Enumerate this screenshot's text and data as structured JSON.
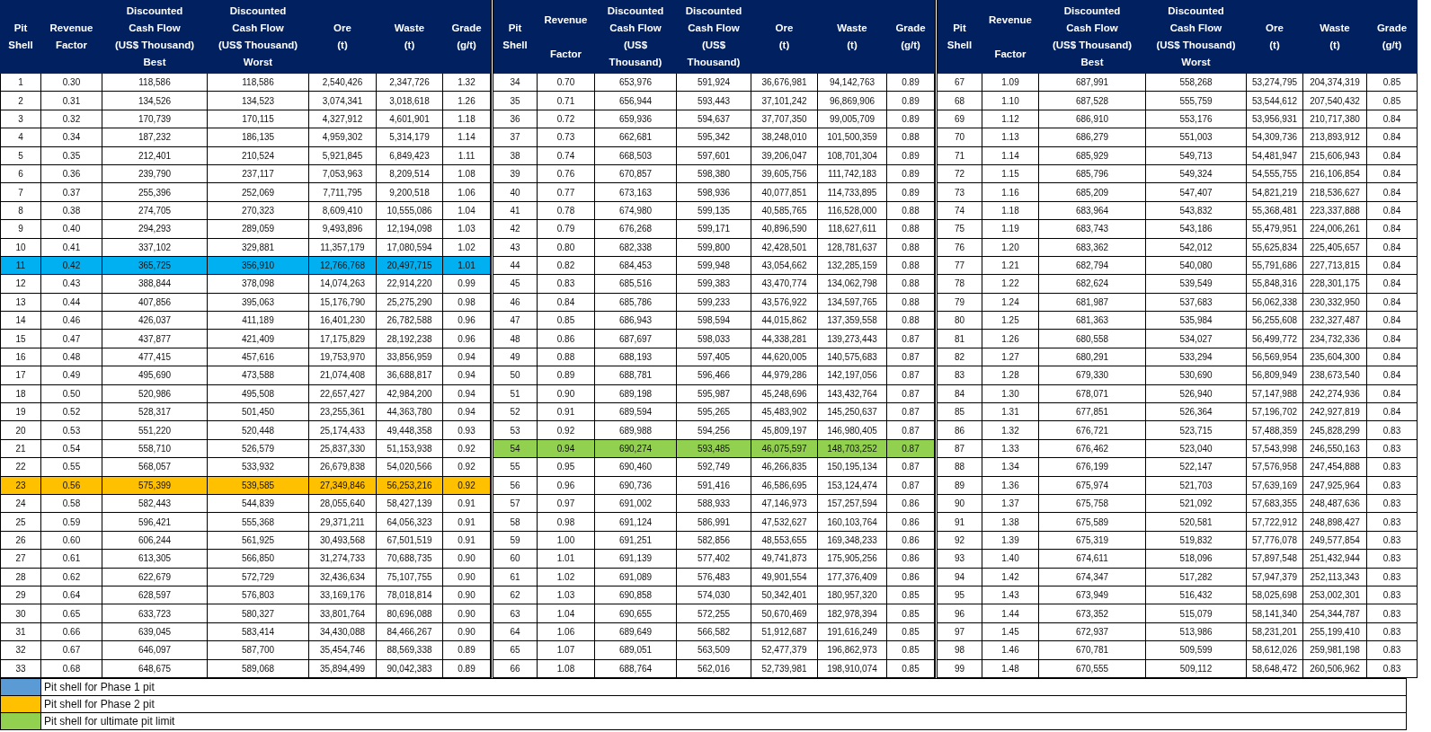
{
  "blocks": [
    {
      "columns": [
        "Pit\nShell",
        "Revenue\nFactor",
        "Discounted\nCash Flow\n(US$ Thousand)\nBest",
        "Discounted\nCash Flow\n(US$ Thousand)\nWorst",
        "Ore\n(t)",
        "Waste\n(t)",
        "Grade\n(g/t)"
      ],
      "rows": [
        {
          "cells": [
            "1",
            "0.30",
            "118,586",
            "118,586",
            "2,540,426",
            "2,347,726",
            "1.32"
          ]
        },
        {
          "cells": [
            "2",
            "0.31",
            "134,526",
            "134,523",
            "3,074,341",
            "3,018,618",
            "1.26"
          ]
        },
        {
          "cells": [
            "3",
            "0.32",
            "170,739",
            "170,115",
            "4,327,912",
            "4,601,901",
            "1.18"
          ]
        },
        {
          "cells": [
            "4",
            "0.34",
            "187,232",
            "186,135",
            "4,959,302",
            "5,314,179",
            "1.14"
          ]
        },
        {
          "cells": [
            "5",
            "0.35",
            "212,401",
            "210,524",
            "5,921,845",
            "6,849,423",
            "1.11"
          ]
        },
        {
          "cells": [
            "6",
            "0.36",
            "239,790",
            "237,117",
            "7,053,963",
            "8,209,514",
            "1.08"
          ]
        },
        {
          "cells": [
            "7",
            "0.37",
            "255,396",
            "252,069",
            "7,711,795",
            "9,200,518",
            "1.06"
          ]
        },
        {
          "cells": [
            "8",
            "0.38",
            "274,705",
            "270,323",
            "8,609,410",
            "10,555,086",
            "1.04"
          ]
        },
        {
          "cells": [
            "9",
            "0.40",
            "294,293",
            "289,059",
            "9,493,896",
            "12,194,098",
            "1.03"
          ]
        },
        {
          "cells": [
            "10",
            "0.41",
            "337,102",
            "329,881",
            "11,357,179",
            "17,080,594",
            "1.02"
          ]
        },
        {
          "cells": [
            "11",
            "0.42",
            "365,725",
            "356,910",
            "12,766,768",
            "20,497,715",
            "1.01"
          ],
          "color": "#00b0f0"
        },
        {
          "cells": [
            "12",
            "0.43",
            "388,844",
            "378,098",
            "14,074,263",
            "22,914,220",
            "0.99"
          ]
        },
        {
          "cells": [
            "13",
            "0.44",
            "407,856",
            "395,063",
            "15,176,790",
            "25,275,290",
            "0.98"
          ]
        },
        {
          "cells": [
            "14",
            "0.46",
            "426,037",
            "411,189",
            "16,401,230",
            "26,782,588",
            "0.96"
          ]
        },
        {
          "cells": [
            "15",
            "0.47",
            "437,877",
            "421,409",
            "17,175,829",
            "28,192,238",
            "0.96"
          ]
        },
        {
          "cells": [
            "16",
            "0.48",
            "477,415",
            "457,616",
            "19,753,970",
            "33,856,959",
            "0.94"
          ]
        },
        {
          "cells": [
            "17",
            "0.49",
            "495,690",
            "473,588",
            "21,074,408",
            "36,688,817",
            "0.94"
          ]
        },
        {
          "cells": [
            "18",
            "0.50",
            "520,986",
            "495,508",
            "22,657,427",
            "42,984,200",
            "0.94"
          ]
        },
        {
          "cells": [
            "19",
            "0.52",
            "528,317",
            "501,450",
            "23,255,361",
            "44,363,780",
            "0.94"
          ]
        },
        {
          "cells": [
            "20",
            "0.53",
            "551,220",
            "520,448",
            "25,174,433",
            "49,448,358",
            "0.93"
          ]
        },
        {
          "cells": [
            "21",
            "0.54",
            "558,710",
            "526,579",
            "25,837,330",
            "51,153,938",
            "0.92"
          ]
        },
        {
          "cells": [
            "22",
            "0.55",
            "568,057",
            "533,932",
            "26,679,838",
            "54,020,566",
            "0.92"
          ]
        },
        {
          "cells": [
            "23",
            "0.56",
            "575,399",
            "539,585",
            "27,349,846",
            "56,253,216",
            "0.92"
          ],
          "color": "#ffc000"
        },
        {
          "cells": [
            "24",
            "0.58",
            "582,443",
            "544,839",
            "28,055,640",
            "58,427,139",
            "0.91"
          ]
        },
        {
          "cells": [
            "25",
            "0.59",
            "596,421",
            "555,368",
            "29,371,211",
            "64,056,323",
            "0.91"
          ]
        },
        {
          "cells": [
            "26",
            "0.60",
            "606,244",
            "561,925",
            "30,493,568",
            "67,501,519",
            "0.91"
          ]
        },
        {
          "cells": [
            "27",
            "0.61",
            "613,305",
            "566,850",
            "31,274,733",
            "70,688,735",
            "0.90"
          ]
        },
        {
          "cells": [
            "28",
            "0.62",
            "622,679",
            "572,729",
            "32,436,634",
            "75,107,755",
            "0.90"
          ]
        },
        {
          "cells": [
            "29",
            "0.64",
            "628,597",
            "576,803",
            "33,169,176",
            "78,018,814",
            "0.90"
          ]
        },
        {
          "cells": [
            "30",
            "0.65",
            "633,723",
            "580,327",
            "33,801,764",
            "80,696,088",
            "0.90"
          ]
        },
        {
          "cells": [
            "31",
            "0.66",
            "639,045",
            "583,414",
            "34,430,088",
            "84,466,267",
            "0.90"
          ]
        },
        {
          "cells": [
            "32",
            "0.67",
            "646,097",
            "587,700",
            "35,454,746",
            "88,569,338",
            "0.89"
          ]
        },
        {
          "cells": [
            "33",
            "0.68",
            "648,675",
            "589,068",
            "35,894,499",
            "90,042,383",
            "0.89"
          ]
        }
      ]
    },
    {
      "columns": [
        "Pit\nShell",
        "Revenue\n\nFactor",
        "Discounted\nCash Flow\n(US$\nThousand)",
        "Discounted\nCash Flow\n(US$\nThousand)",
        "Ore\n(t)",
        "Waste\n(t)",
        "Grade\n(g/t)"
      ],
      "rows": [
        {
          "cells": [
            "34",
            "0.70",
            "653,976",
            "591,924",
            "36,676,981",
            "94,142,763",
            "0.89"
          ]
        },
        {
          "cells": [
            "35",
            "0.71",
            "656,944",
            "593,443",
            "37,101,242",
            "96,869,906",
            "0.89"
          ]
        },
        {
          "cells": [
            "36",
            "0.72",
            "659,936",
            "594,637",
            "37,707,350",
            "99,005,709",
            "0.89"
          ]
        },
        {
          "cells": [
            "37",
            "0.73",
            "662,681",
            "595,342",
            "38,248,010",
            "101,500,359",
            "0.88"
          ]
        },
        {
          "cells": [
            "38",
            "0.74",
            "668,503",
            "597,601",
            "39,206,047",
            "108,701,304",
            "0.89"
          ]
        },
        {
          "cells": [
            "39",
            "0.76",
            "670,857",
            "598,380",
            "39,605,756",
            "111,742,183",
            "0.89"
          ]
        },
        {
          "cells": [
            "40",
            "0.77",
            "673,163",
            "598,936",
            "40,077,851",
            "114,733,895",
            "0.89"
          ]
        },
        {
          "cells": [
            "41",
            "0.78",
            "674,980",
            "599,135",
            "40,585,765",
            "116,528,000",
            "0.88"
          ]
        },
        {
          "cells": [
            "42",
            "0.79",
            "676,268",
            "599,171",
            "40,896,590",
            "118,627,611",
            "0.88"
          ]
        },
        {
          "cells": [
            "43",
            "0.80",
            "682,338",
            "599,800",
            "42,428,501",
            "128,781,637",
            "0.88"
          ]
        },
        {
          "cells": [
            "44",
            "0.82",
            "684,453",
            "599,948",
            "43,054,662",
            "132,285,159",
            "0.88"
          ]
        },
        {
          "cells": [
            "45",
            "0.83",
            "685,516",
            "599,383",
            "43,470,774",
            "134,062,798",
            "0.88"
          ]
        },
        {
          "cells": [
            "46",
            "0.84",
            "685,786",
            "599,233",
            "43,576,922",
            "134,597,765",
            "0.88"
          ]
        },
        {
          "cells": [
            "47",
            "0.85",
            "686,943",
            "598,594",
            "44,015,862",
            "137,359,558",
            "0.88"
          ]
        },
        {
          "cells": [
            "48",
            "0.86",
            "687,697",
            "598,033",
            "44,338,281",
            "139,273,443",
            "0.87"
          ]
        },
        {
          "cells": [
            "49",
            "0.88",
            "688,193",
            "597,405",
            "44,620,005",
            "140,575,683",
            "0.87"
          ]
        },
        {
          "cells": [
            "50",
            "0.89",
            "688,781",
            "596,466",
            "44,979,286",
            "142,197,056",
            "0.87"
          ]
        },
        {
          "cells": [
            "51",
            "0.90",
            "689,198",
            "595,987",
            "45,248,696",
            "143,432,764",
            "0.87"
          ]
        },
        {
          "cells": [
            "52",
            "0.91",
            "689,594",
            "595,265",
            "45,483,902",
            "145,250,637",
            "0.87"
          ]
        },
        {
          "cells": [
            "53",
            "0.92",
            "689,988",
            "594,256",
            "45,809,197",
            "146,980,405",
            "0.87"
          ]
        },
        {
          "cells": [
            "54",
            "0.94",
            "690,274",
            "593,485",
            "46,075,597",
            "148,703,252",
            "0.87"
          ],
          "color": "#92d050"
        },
        {
          "cells": [
            "55",
            "0.95",
            "690,460",
            "592,749",
            "46,266,835",
            "150,195,134",
            "0.87"
          ]
        },
        {
          "cells": [
            "56",
            "0.96",
            "690,736",
            "591,416",
            "46,586,695",
            "153,124,474",
            "0.87"
          ]
        },
        {
          "cells": [
            "57",
            "0.97",
            "691,002",
            "588,933",
            "47,146,973",
            "157,257,594",
            "0.86"
          ]
        },
        {
          "cells": [
            "58",
            "0.98",
            "691,124",
            "586,991",
            "47,532,627",
            "160,103,764",
            "0.86"
          ]
        },
        {
          "cells": [
            "59",
            "1.00",
            "691,251",
            "582,856",
            "48,553,655",
            "169,348,233",
            "0.86"
          ]
        },
        {
          "cells": [
            "60",
            "1.01",
            "691,139",
            "577,402",
            "49,741,873",
            "175,905,256",
            "0.86"
          ]
        },
        {
          "cells": [
            "61",
            "1.02",
            "691,089",
            "576,483",
            "49,901,554",
            "177,376,409",
            "0.86"
          ]
        },
        {
          "cells": [
            "62",
            "1.03",
            "690,858",
            "574,030",
            "50,342,401",
            "180,957,320",
            "0.85"
          ]
        },
        {
          "cells": [
            "63",
            "1.04",
            "690,655",
            "572,255",
            "50,670,469",
            "182,978,394",
            "0.85"
          ]
        },
        {
          "cells": [
            "64",
            "1.06",
            "689,649",
            "566,582",
            "51,912,687",
            "191,616,249",
            "0.85"
          ]
        },
        {
          "cells": [
            "65",
            "1.07",
            "689,051",
            "563,509",
            "52,477,379",
            "196,862,973",
            "0.85"
          ]
        },
        {
          "cells": [
            "66",
            "1.08",
            "688,764",
            "562,016",
            "52,739,981",
            "198,910,074",
            "0.85"
          ]
        }
      ]
    },
    {
      "columns": [
        "Pit\nShell",
        "Revenue\n\nFactor",
        "Discounted\nCash Flow\n(US$ Thousand)\nBest",
        "Discounted\nCash Flow\n(US$ Thousand)\nWorst",
        "Ore\n(t)",
        "Waste\n(t)",
        "Grade\n(g/t)"
      ],
      "rows": [
        {
          "cells": [
            "67",
            "1.09",
            "687,991",
            "558,268",
            "53,274,795",
            "204,374,319",
            "0.85"
          ]
        },
        {
          "cells": [
            "68",
            "1.10",
            "687,528",
            "555,759",
            "53,544,612",
            "207,540,432",
            "0.85"
          ]
        },
        {
          "cells": [
            "69",
            "1.12",
            "686,910",
            "553,176",
            "53,956,931",
            "210,717,380",
            "0.84"
          ]
        },
        {
          "cells": [
            "70",
            "1.13",
            "686,279",
            "551,003",
            "54,309,736",
            "213,893,912",
            "0.84"
          ]
        },
        {
          "cells": [
            "71",
            "1.14",
            "685,929",
            "549,713",
            "54,481,947",
            "215,606,943",
            "0.84"
          ]
        },
        {
          "cells": [
            "72",
            "1.15",
            "685,796",
            "549,324",
            "54,555,755",
            "216,106,854",
            "0.84"
          ]
        },
        {
          "cells": [
            "73",
            "1.16",
            "685,209",
            "547,407",
            "54,821,219",
            "218,536,627",
            "0.84"
          ]
        },
        {
          "cells": [
            "74",
            "1.18",
            "683,964",
            "543,832",
            "55,368,481",
            "223,337,888",
            "0.84"
          ]
        },
        {
          "cells": [
            "75",
            "1.19",
            "683,743",
            "543,186",
            "55,479,951",
            "224,006,261",
            "0.84"
          ]
        },
        {
          "cells": [
            "76",
            "1.20",
            "683,362",
            "542,012",
            "55,625,834",
            "225,405,657",
            "0.84"
          ]
        },
        {
          "cells": [
            "77",
            "1.21",
            "682,794",
            "540,080",
            "55,791,686",
            "227,713,815",
            "0.84"
          ]
        },
        {
          "cells": [
            "78",
            "1.22",
            "682,624",
            "539,549",
            "55,848,316",
            "228,301,175",
            "0.84"
          ]
        },
        {
          "cells": [
            "79",
            "1.24",
            "681,987",
            "537,683",
            "56,062,338",
            "230,332,950",
            "0.84"
          ]
        },
        {
          "cells": [
            "80",
            "1.25",
            "681,363",
            "535,984",
            "56,255,608",
            "232,327,487",
            "0.84"
          ]
        },
        {
          "cells": [
            "81",
            "1.26",
            "680,558",
            "534,027",
            "56,499,772",
            "234,732,336",
            "0.84"
          ]
        },
        {
          "cells": [
            "82",
            "1.27",
            "680,291",
            "533,294",
            "56,569,954",
            "235,604,300",
            "0.84"
          ]
        },
        {
          "cells": [
            "83",
            "1.28",
            "679,330",
            "530,690",
            "56,809,949",
            "238,673,540",
            "0.84"
          ]
        },
        {
          "cells": [
            "84",
            "1.30",
            "678,071",
            "526,940",
            "57,147,988",
            "242,274,936",
            "0.84"
          ]
        },
        {
          "cells": [
            "85",
            "1.31",
            "677,851",
            "526,364",
            "57,196,702",
            "242,927,819",
            "0.84"
          ]
        },
        {
          "cells": [
            "86",
            "1.32",
            "676,721",
            "523,715",
            "57,488,359",
            "245,828,299",
            "0.83"
          ]
        },
        {
          "cells": [
            "87",
            "1.33",
            "676,462",
            "523,040",
            "57,543,998",
            "246,550,163",
            "0.83"
          ]
        },
        {
          "cells": [
            "88",
            "1.34",
            "676,199",
            "522,147",
            "57,576,958",
            "247,454,888",
            "0.83"
          ]
        },
        {
          "cells": [
            "89",
            "1.36",
            "675,974",
            "521,703",
            "57,639,169",
            "247,925,964",
            "0.83"
          ]
        },
        {
          "cells": [
            "90",
            "1.37",
            "675,758",
            "521,092",
            "57,683,355",
            "248,487,636",
            "0.83"
          ]
        },
        {
          "cells": [
            "91",
            "1.38",
            "675,589",
            "520,581",
            "57,722,912",
            "248,898,427",
            "0.83"
          ]
        },
        {
          "cells": [
            "92",
            "1.39",
            "675,319",
            "519,832",
            "57,776,078",
            "249,577,854",
            "0.83"
          ]
        },
        {
          "cells": [
            "93",
            "1.40",
            "674,611",
            "518,096",
            "57,897,548",
            "251,432,944",
            "0.83"
          ]
        },
        {
          "cells": [
            "94",
            "1.42",
            "674,347",
            "517,282",
            "57,947,379",
            "252,113,343",
            "0.83"
          ]
        },
        {
          "cells": [
            "95",
            "1.43",
            "673,949",
            "516,432",
            "58,025,698",
            "253,002,301",
            "0.83"
          ]
        },
        {
          "cells": [
            "96",
            "1.44",
            "673,352",
            "515,079",
            "58,141,340",
            "254,344,787",
            "0.83"
          ]
        },
        {
          "cells": [
            "97",
            "1.45",
            "672,937",
            "513,986",
            "58,231,201",
            "255,199,410",
            "0.83"
          ]
        },
        {
          "cells": [
            "98",
            "1.46",
            "670,781",
            "509,599",
            "58,612,026",
            "259,981,198",
            "0.83"
          ]
        },
        {
          "cells": [
            "99",
            "1.48",
            "670,555",
            "509,112",
            "58,648,472",
            "260,506,962",
            "0.83"
          ]
        }
      ]
    }
  ],
  "legend": [
    {
      "color": "#5b9bd5",
      "label": "Pit shell for Phase 1 pit"
    },
    {
      "color": "#ffc000",
      "label": "Pit shell for Phase 2 pit"
    },
    {
      "color": "#92d050",
      "label": "Pit shell for ultimate pit limit"
    }
  ]
}
